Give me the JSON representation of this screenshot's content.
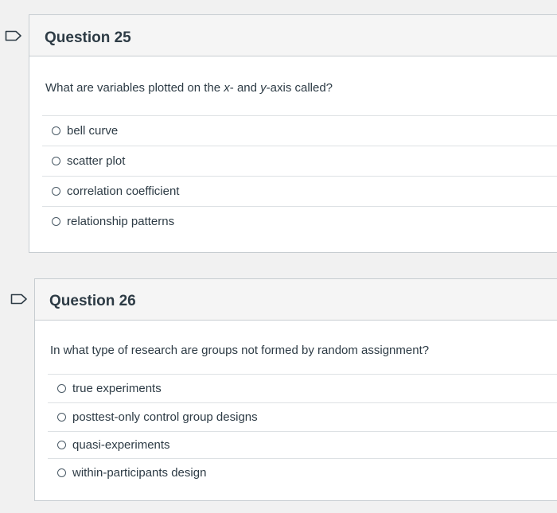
{
  "questions": [
    {
      "title": "Question 25",
      "text_parts": [
        "What are variables plotted on the ",
        "x",
        "- and ",
        "y",
        "-axis called?"
      ],
      "answers": [
        "bell curve",
        "scatter plot",
        "correlation coefficient",
        "relationship patterns"
      ]
    },
    {
      "title": "Question 26",
      "text": "In what type of research are groups not formed by random assignment?",
      "answers": [
        "true experiments",
        "posttest-only control group designs",
        "quasi-experiments",
        "within-participants design"
      ]
    }
  ],
  "colors": {
    "flag_outline": "#2d3b45",
    "border": "#c7cdd1",
    "header_bg": "#f5f5f5",
    "text": "#2d3b45"
  },
  "icons": {
    "flag": "flag-icon",
    "radio": "radio-icon"
  }
}
